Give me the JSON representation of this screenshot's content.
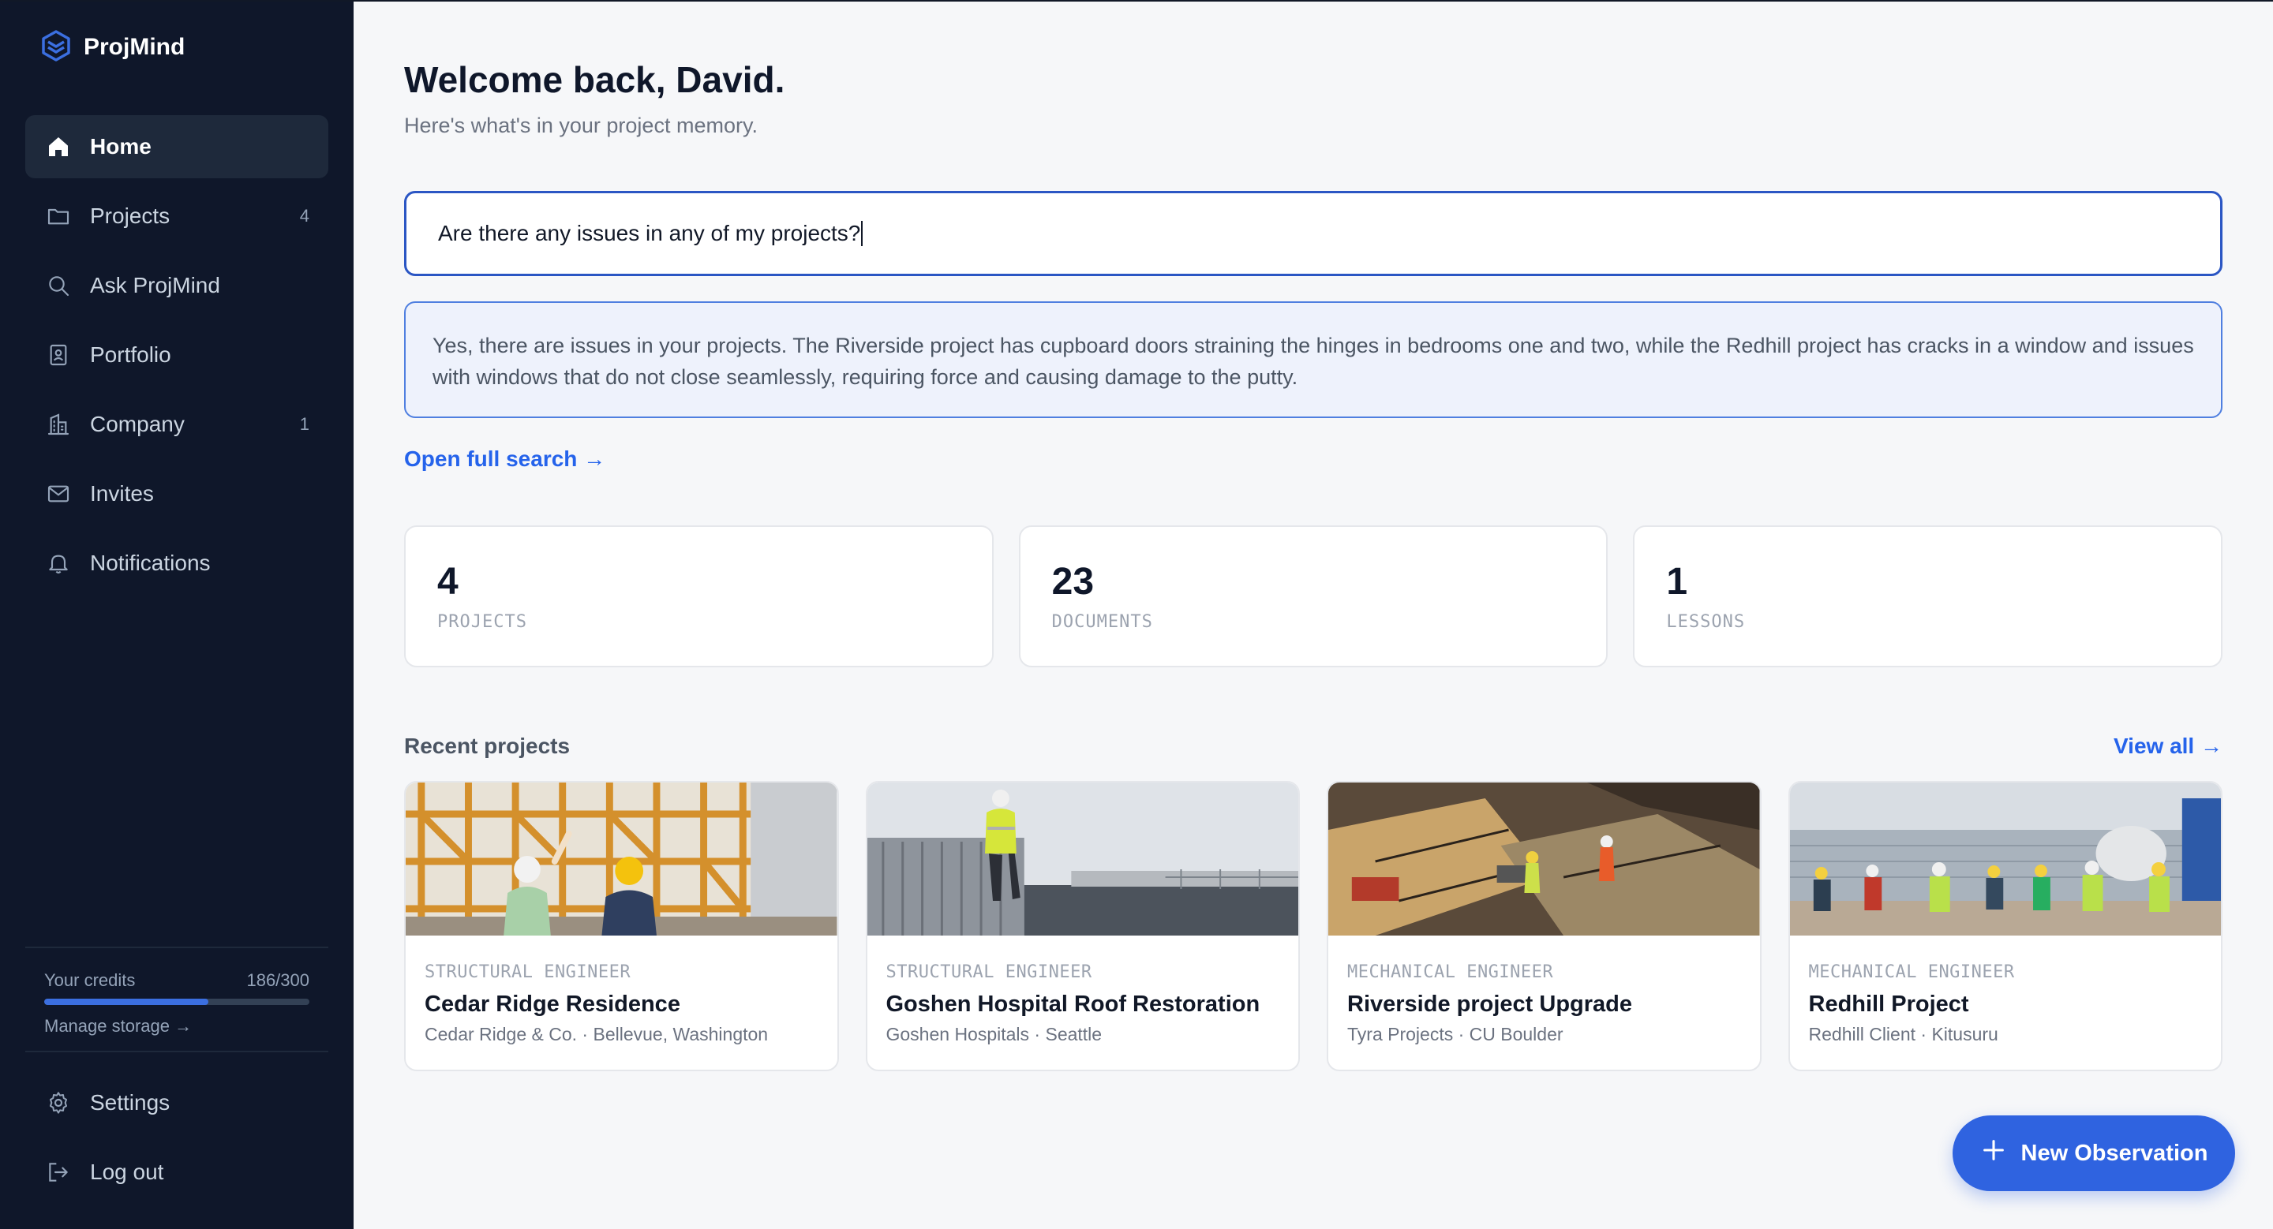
{
  "app": {
    "name": "ProjMind",
    "accent": "#2f63e0"
  },
  "sidebar": {
    "items": [
      {
        "label": "Home",
        "icon": "home-icon",
        "active": true
      },
      {
        "label": "Projects",
        "icon": "folder-icon",
        "count": "4"
      },
      {
        "label": "Ask ProjMind",
        "icon": "search-icon"
      },
      {
        "label": "Portfolio",
        "icon": "portfolio-icon"
      },
      {
        "label": "Company",
        "icon": "building-icon",
        "count": "1"
      },
      {
        "label": "Invites",
        "icon": "mail-icon"
      },
      {
        "label": "Notifications",
        "icon": "bell-icon"
      }
    ],
    "credits": {
      "label": "Your credits",
      "value": "186/300",
      "fraction": 0.62,
      "manage": "Manage storage →"
    },
    "bottom": [
      {
        "label": "Settings",
        "icon": "gear-icon"
      },
      {
        "label": "Log out",
        "icon": "logout-icon"
      }
    ]
  },
  "main": {
    "welcome": "Welcome back, David.",
    "subtitle": "Here's what's in your project memory.",
    "search_value": "Are there any issues in any of my projects?",
    "answer": "Yes, there are issues in your projects. The Riverside project has cupboard doors straining the hinges in bedrooms one and two, while the Redhill project has cracks in a window and issues with windows that do not close seamlessly, requiring force and causing damage to the putty.",
    "open_full_search": "Open full search →",
    "stats": [
      {
        "value": "4",
        "label": "PROJECTS"
      },
      {
        "value": "23",
        "label": "DOCUMENTS"
      },
      {
        "value": "1",
        "label": "LESSONS"
      }
    ],
    "recent_title": "Recent projects",
    "view_all": "View all →",
    "projects": [
      {
        "role": "STRUCTURAL ENGINEER",
        "name": "Cedar Ridge Residence",
        "meta": "Cedar Ridge & Co. · Bellevue, Washington",
        "image": "construction-scaffold-photo"
      },
      {
        "role": "STRUCTURAL ENGINEER",
        "name": "Goshen Hospital Roof Restoration",
        "meta": "Goshen Hospitals · Seattle",
        "image": "rooftop-worker-photo"
      },
      {
        "role": "MECHANICAL ENGINEER",
        "name": "Riverside project Upgrade",
        "meta": "Tyra Projects · CU Boulder",
        "image": "worksite-aerial-photo"
      },
      {
        "role": "MECHANICAL ENGINEER",
        "name": "Redhill Project",
        "meta": "Redhill Client · Kitusuru",
        "image": "crew-concrete-photo"
      }
    ],
    "fab_label": "New Observation"
  }
}
